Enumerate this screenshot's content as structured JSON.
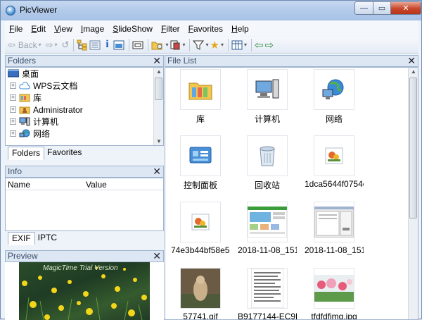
{
  "window": {
    "title": "PicViewer",
    "controls": {
      "minimize": "—",
      "maximize": "▭",
      "close": "✕"
    }
  },
  "menu": [
    {
      "key": "F",
      "rest": "ile"
    },
    {
      "key": "E",
      "rest": "dit"
    },
    {
      "key": "V",
      "rest": "iew"
    },
    {
      "key": "I",
      "rest": "mage"
    },
    {
      "key": "S",
      "rest": "lideShow"
    },
    {
      "key": "F",
      "rest": "ilter"
    },
    {
      "key": "F",
      "rest": "avorites"
    },
    {
      "key": "H",
      "rest": "elp"
    }
  ],
  "toolbar": {
    "back_label": "Back",
    "icons": [
      "back-arrow-icon",
      "forward-arrow-icon",
      "up-icon",
      "folders-tree-icon",
      "details-icon",
      "info-icon",
      "preview-icon",
      "slideshow-icon",
      "open-folder-icon",
      "copy-icon",
      "filter-icon",
      "favorites-star-icon",
      "view-mode-icon",
      "nav-left-icon",
      "nav-right-icon"
    ]
  },
  "folders_panel": {
    "title": "Folders",
    "close": "✕",
    "items": [
      {
        "label": "桌面",
        "icon": "desktop-icon",
        "expander": ""
      },
      {
        "label": "WPS云文档",
        "icon": "cloud-icon",
        "expander": "+"
      },
      {
        "label": "库",
        "icon": "library-icon",
        "expander": "+"
      },
      {
        "label": "Administrator",
        "icon": "user-folder-icon",
        "expander": "+"
      },
      {
        "label": "计算机",
        "icon": "computer-icon",
        "expander": "+"
      },
      {
        "label": "网络",
        "icon": "network-icon",
        "expander": "+"
      }
    ],
    "tabs": [
      "Folders",
      "Favorites"
    ]
  },
  "info_panel": {
    "title": "Info",
    "close": "✕",
    "columns": [
      "Name",
      "Value"
    ],
    "tabs": [
      "EXIF",
      "IPTC"
    ]
  },
  "preview_panel": {
    "title": "Preview",
    "close": "✕",
    "watermark": "MagicTime Trial Version"
  },
  "file_list": {
    "title": "File List",
    "close": "✕",
    "items": [
      {
        "label": "库",
        "kind": "library"
      },
      {
        "label": "计算机",
        "kind": "computer"
      },
      {
        "label": "网络",
        "kind": "network"
      },
      {
        "label": "控制面板",
        "kind": "control-panel"
      },
      {
        "label": "回收站",
        "kind": "recycle-bin"
      },
      {
        "label": "1dca5644f0754c...",
        "kind": "image"
      },
      {
        "label": "74e3b44bf58e5c...",
        "kind": "image"
      },
      {
        "label": "2018-11-08_151...",
        "kind": "screenshot"
      },
      {
        "label": "2018-11-08_151...",
        "kind": "screenshot"
      },
      {
        "label": "57741.gif",
        "kind": "photo"
      },
      {
        "label": "B9177144-EC9F-...",
        "kind": "document"
      },
      {
        "label": "tfdfdfimg.jpg",
        "kind": "photo"
      }
    ]
  },
  "colors": {
    "accent": "#6f8bb3",
    "panel_header": "#dde7f3",
    "close_button": "#c8462a"
  }
}
